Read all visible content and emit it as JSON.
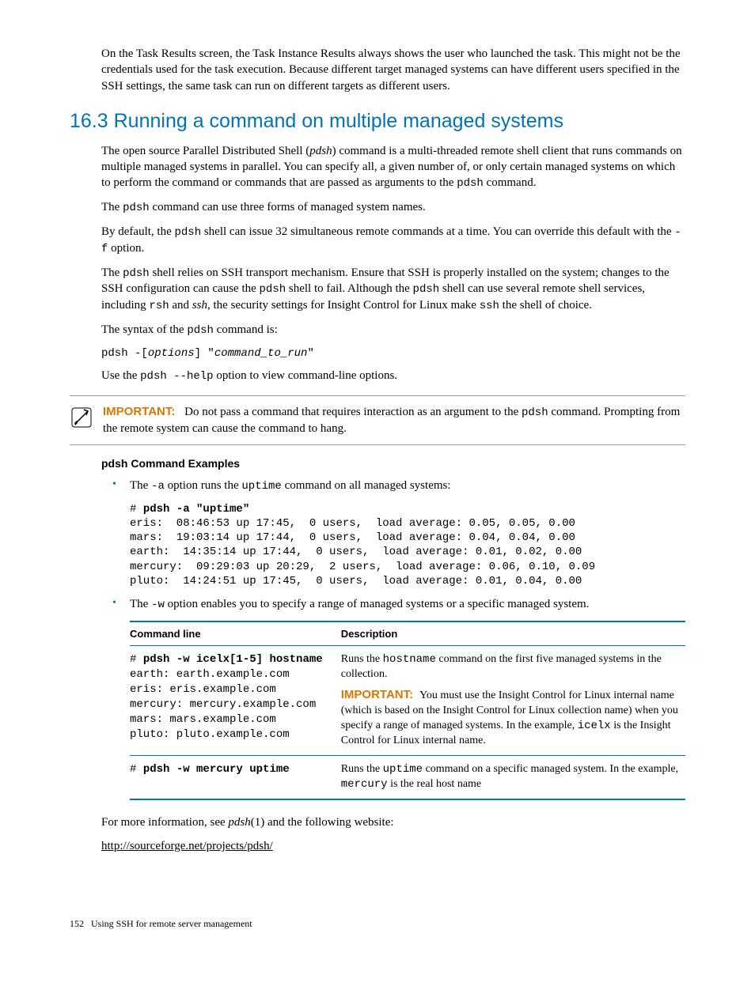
{
  "intro_para": "On the Task Results screen, the Task Instance Results always shows the user who launched the task. This might not be the credentials used for the task execution. Because different target managed systems can have different users specified in the SSH settings, the same task can run on different targets as different users.",
  "section_number": "16.3",
  "section_title": "Running a command on multiple managed systems",
  "p1_a": "The open source Parallel Distributed Shell (",
  "p1_pdsh": "pdsh",
  "p1_b": ") command is a multi-threaded remote shell client that runs commands on multiple managed systems in parallel. You can specify all, a given number of, or only certain managed systems on which to perform the command or commands that are passed as arguments to the ",
  "p1_pdsh2": "pdsh",
  "p1_c": " command.",
  "p2_a": "The ",
  "p2_pdsh": "pdsh",
  "p2_b": " command can use three forms of managed system names.",
  "p3_a": "By default, the ",
  "p3_pdsh": "pdsh",
  "p3_b": " shell can issue 32 simultaneous remote commands at a time. You can override this default with the ",
  "p3_f": "-f",
  "p3_c": " option.",
  "p4_a": "The ",
  "p4_pdsh": "pdsh",
  "p4_b": " shell relies on SSH transport mechanism. Ensure that SSH is properly installed on the system; changes to the SSH configuration can cause the ",
  "p4_pdsh2": "pdsh",
  "p4_c": " shell to fail. Although the ",
  "p4_pdsh3": "pdsh",
  "p4_d": " shell can use several remote shell services, including ",
  "p4_rsh": "rsh",
  "p4_e": " and ",
  "p4_ssh": "ssh",
  "p4_f": ", the security settings for Insight Control for Linux make ",
  "p4_ssh2": "ssh",
  "p4_g": " the shell of choice.",
  "p5_a": "The syntax of the ",
  "p5_pdsh": "pdsh",
  "p5_b": " command is:",
  "syntax_line_a": "pdsh -[",
  "syntax_options": "options",
  "syntax_line_b": "] \"",
  "syntax_cmd": "command_to_run",
  "syntax_line_c": "\"",
  "p6_a": "Use the ",
  "p6_help": "pdsh --help",
  "p6_b": " option to view command-line options.",
  "important_label": "IMPORTANT:",
  "important_a": "Do not pass a command that requires interaction as an argument to the ",
  "important_pdsh": "pdsh",
  "important_b": " command. Prompting from the remote system can cause the command to hang.",
  "subhead_examples": "pdsh Command Examples",
  "bullet1_a": "The ",
  "bullet1_opt": "-a",
  "bullet1_b": " option runs the ",
  "bullet1_cmd": "uptime",
  "bullet1_c": " command on all managed systems:",
  "code1": "# pdsh -a \"uptime\"\neris:  08:46:53 up 17:45,  0 users,  load average: 0.05, 0.05, 0.00\nmars:  19:03:14 up 17:44,  0 users,  load average: 0.04, 0.04, 0.00\nearth:  14:35:14 up 17:44,  0 users,  load average: 0.01, 0.02, 0.00\nmercury:  09:29:03 up 20:29,  2 users,  load average: 0.06, 0.10, 0.09\npluto:  14:24:51 up 17:45,  0 users,  load average: 0.01, 0.04, 0.00",
  "bullet2_a": "The ",
  "bullet2_opt": "-w",
  "bullet2_b": " option enables you to specify a range of managed systems or a specific managed system.",
  "table": {
    "col1": "Command line",
    "col2": "Description",
    "row1_cmd": "# pdsh -w icelx[1-5] hostname\nearth: earth.example.com\neris: eris.example.com\nmercury: mercury.example.com\nmars: mars.example.com\npluto: pluto.example.com",
    "row1_desc_a": "Runs the ",
    "row1_desc_hostname": "hostname",
    "row1_desc_b": " command on the first five managed systems in the collection.",
    "row1_imp_a": "You must use the Insight Control for Linux internal name (which is based on the Insight Control for Linux collection name) when you specify a range of managed systems. In the example, ",
    "row1_imp_icelx": "icelx",
    "row1_imp_b": " is the Insight Control for Linux internal name.",
    "row2_cmd": "# pdsh -w mercury uptime",
    "row2_desc_a": "Runs the ",
    "row2_desc_uptime": "uptime",
    "row2_desc_b": " command on a specific managed system. In the example, ",
    "row2_desc_mercury": "mercury",
    "row2_desc_c": " is the real host name"
  },
  "closing_a": "For more information, see ",
  "closing_pdsh": "pdsh",
  "closing_b": "(1) and the following website:",
  "link_url": "http://sourceforge.net/projects/pdsh/",
  "footer_page": "152",
  "footer_title": "Using SSH for remote server management"
}
